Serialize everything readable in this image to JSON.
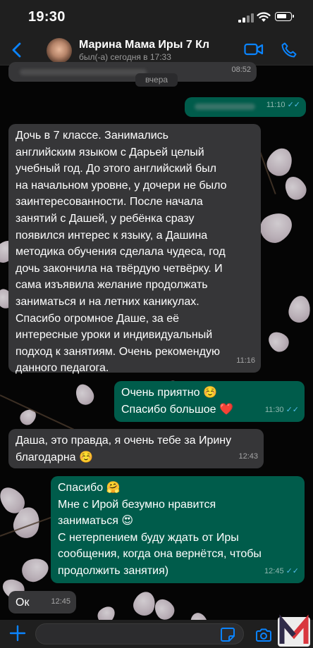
{
  "status_bar": {
    "time": "19:30"
  },
  "header": {
    "contact_name": "Марина Мама Иры 7 Кл",
    "last_seen": "был(-а) сегодня в 17:33"
  },
  "date_chip": "вчера",
  "messages": [
    {
      "id": "m0",
      "direction": "in",
      "time": "08:52"
    },
    {
      "id": "m1",
      "direction": "out",
      "time": "11:10"
    },
    {
      "id": "m2",
      "direction": "in",
      "time": "11:16",
      "lines": [
        "Дочь в 7 классе. Занимались",
        "английским языком  с Дарьей целый",
        "учебный год. До этого английский был",
        "на начальном уровне, у дочери не было",
        "заинтересованности. После начала",
        "занятий с Дашей, у ребёнка сразу",
        "появился интерес к языку, а Дашина",
        "методика обучения сделала чудеса, год",
        "дочь закончила на твёрдую четвёрку. И",
        "сама изъявила желание продолжать",
        "заниматься и на летних каникулах.",
        "Спасибо огромное Даше, за её",
        "интересные уроки и индивидуальный",
        "подход к занятиям. Очень рекомендую",
        "данного педагога."
      ]
    },
    {
      "id": "m3",
      "direction": "out",
      "time": "11:30",
      "lines": [
        "Очень приятно ☺️",
        "Спасибо большое ❤️"
      ]
    },
    {
      "id": "m4",
      "direction": "in",
      "time": "12:43",
      "lines": [
        "Даша, это правда, я очень тебе за Ирину",
        "благодарна ☺️"
      ]
    },
    {
      "id": "m5",
      "direction": "out",
      "time": "12:45",
      "lines": [
        "Спасибо 🤗",
        "Мне с Ирой безумно нравится",
        "заниматься 😍",
        "С нетерпением буду ждать от Иры",
        "сообщения, когда она вернётся, чтобы",
        "продолжить занятия)"
      ]
    },
    {
      "id": "m6",
      "direction": "in",
      "time": "12:45",
      "lines": [
        "Ок"
      ]
    }
  ],
  "colors": {
    "incoming_bubble": "#363638",
    "outgoing_bubble": "#005c4b",
    "read_ticks": "#53bdeb",
    "accent": "#0a84ff"
  },
  "icons": [
    "back-chevron-icon",
    "video-call-icon",
    "phone-icon",
    "plus-icon",
    "sticker-icon",
    "camera-icon",
    "watermark-logo"
  ]
}
